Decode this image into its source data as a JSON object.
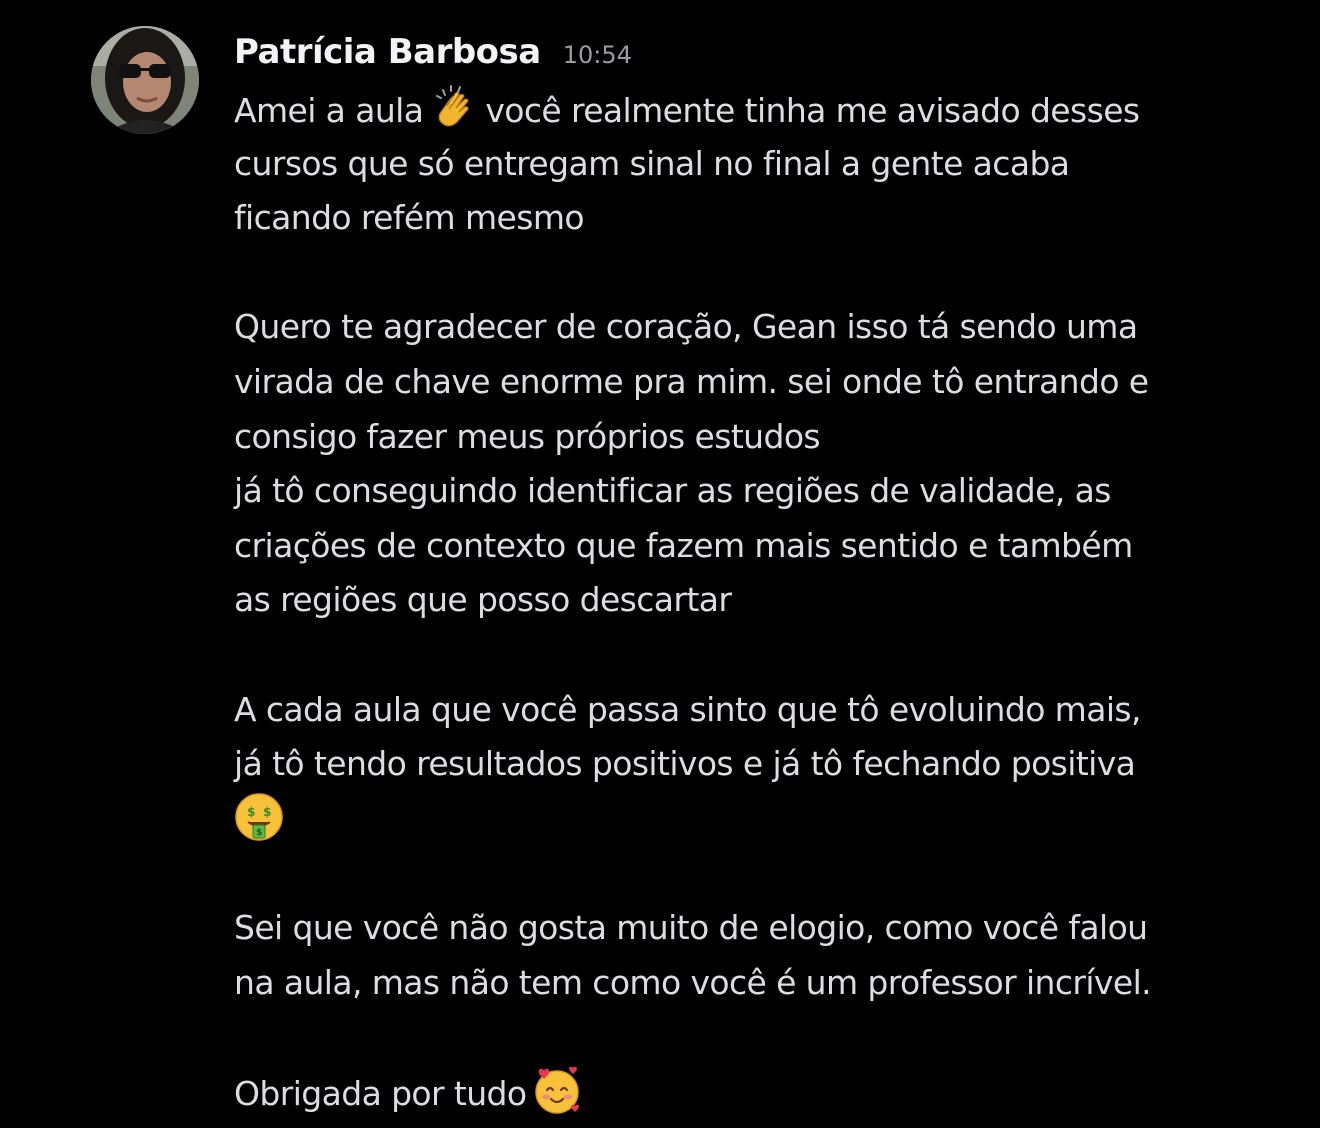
{
  "message": {
    "author": "Patrícia Barbosa",
    "timestamp": "10:54",
    "paragraphs": {
      "p1": {
        "l1a": "Amei a aula",
        "l1b": "você realmente tinha me avisado desses",
        "l2": "cursos que só entregam sinal no final a gente acaba",
        "l3": "ficando refém mesmo"
      },
      "p2": {
        "l1": "Quero te agradecer de coração, Gean isso tá sendo uma",
        "l2": "virada de chave enorme pra mim. sei onde tô entrando e",
        "l3": "consigo fazer meus próprios estudos",
        "l4": "já tô conseguindo identificar as regiões de validade, as",
        "l5": "criações de contexto que fazem mais sentido e também",
        "l6": "as regiões que posso descartar"
      },
      "p3": {
        "l1": "A cada aula que você passa sinto que tô evoluindo mais,",
        "l2": "já tô tendo resultados positivos e já tô fechando positiva"
      },
      "p4": {
        "l1": "Sei que você não gosta muito de elogio, como você falou",
        "l2": "na aula, mas não tem como você é um professor incrível."
      },
      "p5": {
        "l1": "Obrigada por tudo"
      }
    },
    "emojis": [
      "clapping-hands",
      "money-mouth-face",
      "smiling-face-with-hearts"
    ]
  },
  "colors": {
    "background": "#000000",
    "author": "#f2f3f5",
    "text": "#dcdde0",
    "timestamp": "#9a9ca3"
  }
}
